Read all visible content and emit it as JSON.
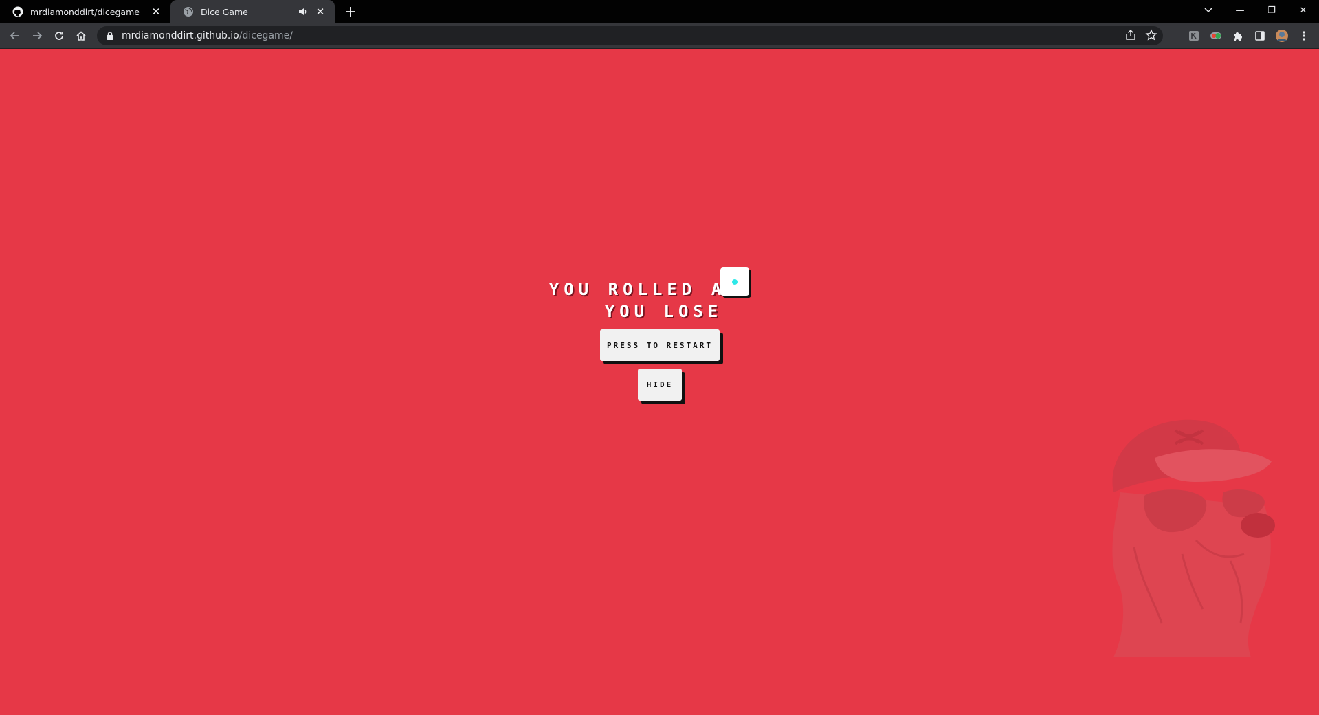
{
  "browser": {
    "tabs": [
      {
        "title": "mrdiamonddirt/dicegame",
        "favicon": "github-icon",
        "active": false
      },
      {
        "title": "Dice Game",
        "favicon": "globe-icon",
        "active": true,
        "audio": true
      }
    ],
    "url_host": "mrdiamonddirt.github.io",
    "url_path": "/dicegame/"
  },
  "game": {
    "rolled_text": "YOU ROLLED A",
    "result_text": "YOU LOSE",
    "die_value": 1,
    "restart_label": "PRESS TO RESTART",
    "hide_label": "HIDE"
  },
  "colors": {
    "page_bg": "#e63847",
    "pip": "#2ee8e8",
    "button_bg": "#f1f1f1",
    "tabstrip_bg": "#020202",
    "toolbar_bg": "#35363a"
  }
}
